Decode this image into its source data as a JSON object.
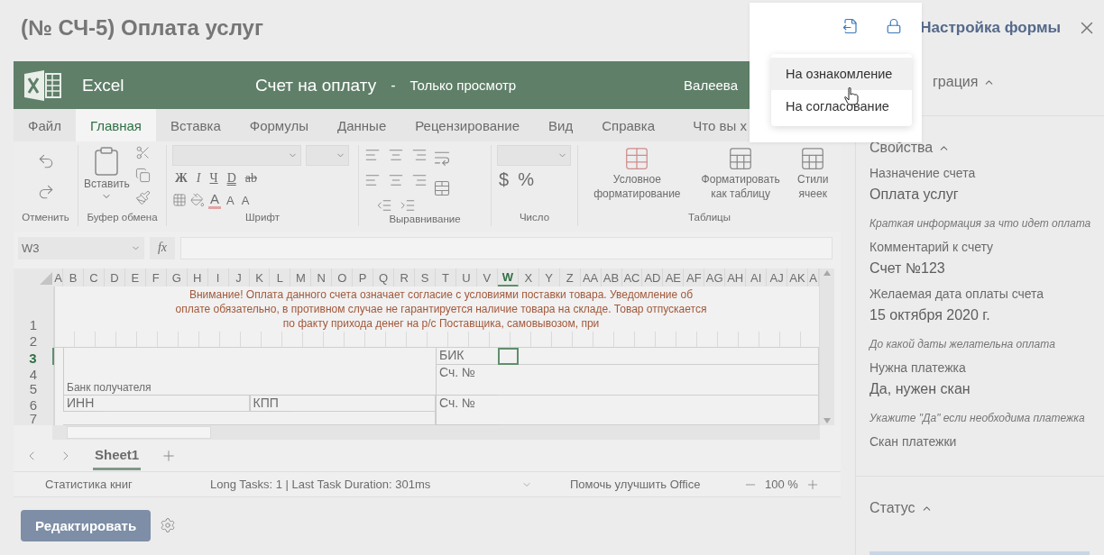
{
  "page": {
    "title": "(№ СЧ-5) Оплата услуг",
    "settings_link": "Настройка формы"
  },
  "excel": {
    "app_name": "Excel",
    "doc_title": "Счет на оплату",
    "separator": "-",
    "mode": "Только просмотр",
    "user": "Валеева",
    "tabs": [
      {
        "label": "Файл",
        "selected": false
      },
      {
        "label": "Главная",
        "selected": true
      },
      {
        "label": "Вставка",
        "selected": false
      },
      {
        "label": "Формулы",
        "selected": false
      },
      {
        "label": "Данные",
        "selected": false
      },
      {
        "label": "Рецензирование",
        "selected": false
      },
      {
        "label": "Вид",
        "selected": false
      },
      {
        "label": "Справка",
        "selected": false
      }
    ],
    "tell_me": "Что вы х",
    "ribbon": {
      "undo": {
        "label": "Отменить"
      },
      "clipboard": {
        "paste": "Вставить",
        "label": "Буфер обмена"
      },
      "font": {
        "style_glyphs": [
          "Ж",
          "I",
          "Ч",
          "D",
          "ab"
        ],
        "color_glyphs": [
          "A",
          "A",
          "A"
        ],
        "label": "Шрифт"
      },
      "alignment": {
        "label": "Выравнивание"
      },
      "number": {
        "glyphs": [
          "$",
          "%"
        ],
        "label": "Число"
      },
      "tables": {
        "buttons": [
          "Условное форматирование",
          "Форматировать как таблицу",
          "Стили ячеек"
        ],
        "label": "Таблицы"
      }
    },
    "sheet": {
      "name_box": "W3",
      "formula_icon": "fx",
      "columns": [
        {
          "label": "A",
          "selected": false
        },
        {
          "label": "B",
          "selected": false
        },
        {
          "label": "C",
          "selected": false
        },
        {
          "label": "D",
          "selected": false
        },
        {
          "label": "E",
          "selected": false
        },
        {
          "label": "F",
          "selected": false
        },
        {
          "label": "G",
          "selected": false
        },
        {
          "label": "H",
          "selected": false
        },
        {
          "label": "I",
          "selected": false
        },
        {
          "label": "J",
          "selected": false
        },
        {
          "label": "K",
          "selected": false
        },
        {
          "label": "L",
          "selected": false
        },
        {
          "label": "M",
          "selected": false
        },
        {
          "label": "N",
          "selected": false
        },
        {
          "label": "O",
          "selected": false
        },
        {
          "label": "P",
          "selected": false
        },
        {
          "label": "Q",
          "selected": false
        },
        {
          "label": "R",
          "selected": false
        },
        {
          "label": "S",
          "selected": false
        },
        {
          "label": "T",
          "selected": false
        },
        {
          "label": "U",
          "selected": false
        },
        {
          "label": "V",
          "selected": false
        },
        {
          "label": "W",
          "selected": true
        },
        {
          "label": "X",
          "selected": false
        },
        {
          "label": "Y",
          "selected": false
        },
        {
          "label": "Z",
          "selected": false
        },
        {
          "label": "AA",
          "selected": false
        },
        {
          "label": "AB",
          "selected": false
        },
        {
          "label": "AC",
          "selected": false
        },
        {
          "label": "AD",
          "selected": false
        },
        {
          "label": "AE",
          "selected": false
        },
        {
          "label": "AF",
          "selected": false
        },
        {
          "label": "AG",
          "selected": false
        },
        {
          "label": "AH",
          "selected": false
        },
        {
          "label": "AI",
          "selected": false
        },
        {
          "label": "AJ",
          "selected": false
        },
        {
          "label": "AK",
          "selected": false
        },
        {
          "label": "A",
          "selected": false
        }
      ],
      "rows": [
        {
          "label": "1",
          "selected": false
        },
        {
          "label": "2",
          "selected": false
        },
        {
          "label": "3",
          "selected": true
        },
        {
          "label": "4",
          "selected": false
        },
        {
          "label": "5",
          "selected": false
        },
        {
          "label": "6",
          "selected": false
        },
        {
          "label": "7",
          "selected": false
        }
      ],
      "notice": "Внимание! Оплата данного счета означает согласие с условиями поставки товара. Уведомление об оплате обязательно, в противном случае не гарантируется наличие товара на складе. Товар отпускается по факту прихода денег на р/с Поставщика, самовывозом, при",
      "cells": [
        "Банк получателя",
        "ИНН",
        "КПП",
        "БИК",
        "Сч. №",
        "Сч. №"
      ]
    },
    "sheet_tabs": [
      {
        "label": "Sheet1",
        "selected": true
      }
    ],
    "status": {
      "stats": "Статистика книг",
      "tasks": "Long Tasks: 1 | Last Task Duration: 301ms",
      "feedback": "Помочь улучшить Office",
      "zoom": "100 %"
    }
  },
  "edit_button": "Редактировать",
  "side_panel": {
    "sections": [
      {
        "title": "грация",
        "expanded": true
      },
      {
        "title": "Свойства",
        "expanded": true,
        "fields": [
          {
            "label": "Назначение счета",
            "value": "Оплата услуг",
            "hint": "Краткая информация за что идет оплата"
          },
          {
            "label": "Комментарий к счету",
            "value": "Счет №123"
          },
          {
            "label": "Желаемая дата оплаты счета",
            "value": "15 октября 2020 г.",
            "hint": "До какой даты желательна оплата"
          },
          {
            "label": "Нужна платежка",
            "value": "Да, нужен скан",
            "hint": "Укажите \"Да\" если необходима платежка"
          },
          {
            "label": "Скан платежки"
          }
        ]
      },
      {
        "title": "Статус",
        "expanded": true
      }
    ]
  },
  "popup": {
    "menu": [
      {
        "label": "На ознакомление",
        "highlighted": true
      },
      {
        "label": "На согласование",
        "highlighted": false
      }
    ]
  }
}
